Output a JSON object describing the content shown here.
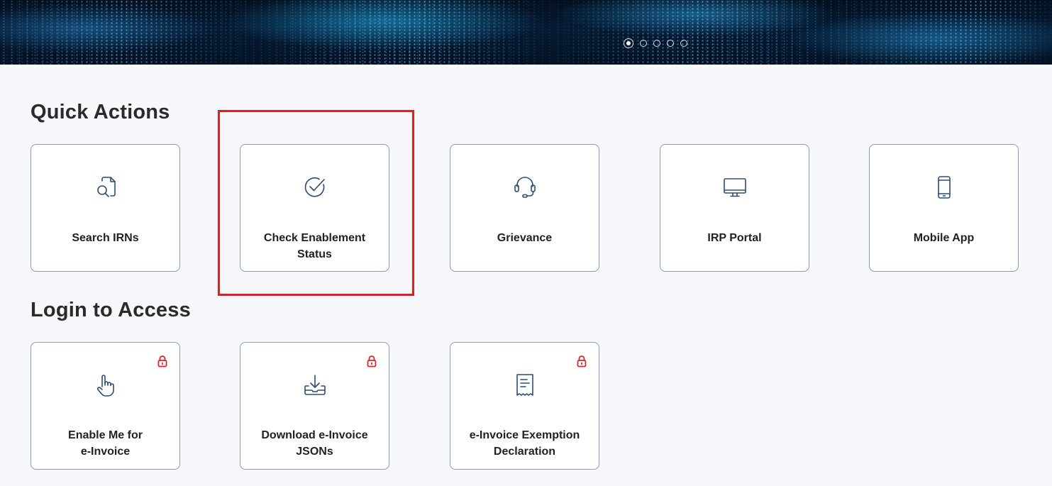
{
  "carousel": {
    "slide_count": 5,
    "active_index": 0
  },
  "quick_actions": {
    "title": "Quick Actions",
    "items": [
      {
        "label": "Search IRNs",
        "icon": "search-document-icon"
      },
      {
        "label": "Check Enablement Status",
        "icon": "check-circle-icon"
      },
      {
        "label": "Grievance",
        "icon": "headset-icon"
      },
      {
        "label": "IRP Portal",
        "icon": "monitor-icon"
      },
      {
        "label": "Mobile App",
        "icon": "mobile-phone-icon"
      }
    ]
  },
  "login_access": {
    "title": "Login to Access",
    "items": [
      {
        "label_line1": "Enable Me for",
        "label_line2": "e-Invoice",
        "icon": "hand-pointer-icon",
        "locked": true
      },
      {
        "label_line1": "Download e-Invoice",
        "label_line2": "JSONs",
        "icon": "download-tray-icon",
        "locked": true
      },
      {
        "label_line1": "e-Invoice Exemption",
        "label_line2": "Declaration",
        "icon": "receipt-icon",
        "locked": true
      }
    ]
  },
  "colors": {
    "icon_stroke": "#2e4a7d",
    "lock": "#e02020",
    "highlight": "#e02020",
    "card_border": "#8d99b5"
  }
}
